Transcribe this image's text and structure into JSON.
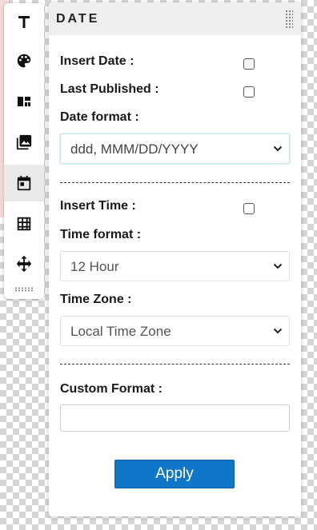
{
  "panel": {
    "title": "DATE",
    "insert_date_label": "Insert Date :",
    "last_published_label": "Last Published :",
    "date_format_label": "Date format :",
    "date_format_value": "ddd, MMM/DD/YYYY",
    "insert_time_label": "Insert Time :",
    "time_format_label": "Time format :",
    "time_format_value": "12 Hour",
    "time_zone_label": "Time Zone :",
    "time_zone_value": "Local Time Zone",
    "custom_format_label": "Custom Format :",
    "custom_format_value": "",
    "apply_label": "Apply",
    "insert_date_checked": false,
    "last_published_checked": false,
    "insert_time_checked": false
  },
  "toolbar": {
    "tools": [
      {
        "icon": "text-icon"
      },
      {
        "icon": "palette-icon"
      },
      {
        "icon": "layout-icon"
      },
      {
        "icon": "image-icon"
      },
      {
        "icon": "calendar-icon",
        "active": true
      },
      {
        "icon": "table-icon"
      },
      {
        "icon": "move-icon"
      }
    ]
  },
  "colors": {
    "accent": "#1076c8",
    "header_bg": "#eeeeee",
    "active_tool_bg": "#eaeaea"
  }
}
